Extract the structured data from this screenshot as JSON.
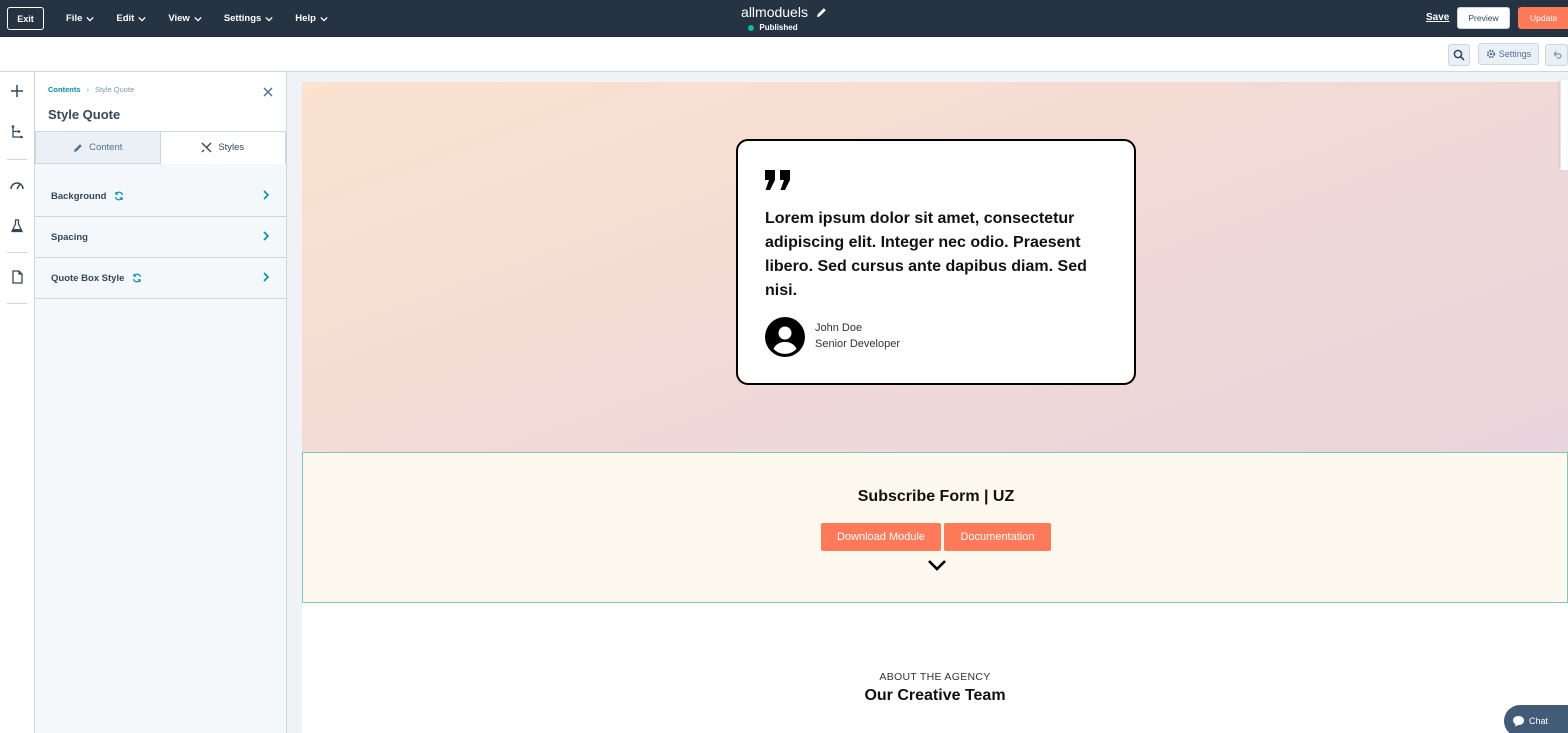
{
  "topbar": {
    "exit_label": "Exit",
    "menu": [
      "File",
      "Edit",
      "View",
      "Settings",
      "Help"
    ],
    "site_name": "allmoduels",
    "status": "Published",
    "save_label": "Save",
    "preview_label": "Preview",
    "update_label": "Update"
  },
  "toolbar": {
    "settings_label": "Settings"
  },
  "panel": {
    "breadcrumb_root": "Contents",
    "breadcrumb_current": "Style Quote",
    "title": "Style Quote",
    "tabs": [
      "Content",
      "Styles"
    ],
    "active_tab": "Styles",
    "sections": [
      {
        "label": "Background",
        "synced": true
      },
      {
        "label": "Spacing",
        "synced": false
      },
      {
        "label": "Quote Box Style",
        "synced": true
      }
    ]
  },
  "quote": {
    "text": "Lorem ipsum dolor sit amet, consectetur adipiscing elit. Integer nec odio. Praesent libero. Sed cursus ante dapibus diam. Sed nisi.",
    "author": "John Doe",
    "role": "Senior Developer"
  },
  "subscribe": {
    "title": "Subscribe Form | UZ",
    "download_label": "Download Module",
    "docs_label": "Documentation"
  },
  "team": {
    "eyebrow": "ABOUT THE AGENCY",
    "title": "Our Creative Team"
  },
  "chat": {
    "label": "Chat"
  },
  "colors": {
    "topbar_bg": "#253342",
    "accent_orange": "#ff7a59",
    "link_teal": "#0091ae",
    "published_green": "#00bda5"
  }
}
